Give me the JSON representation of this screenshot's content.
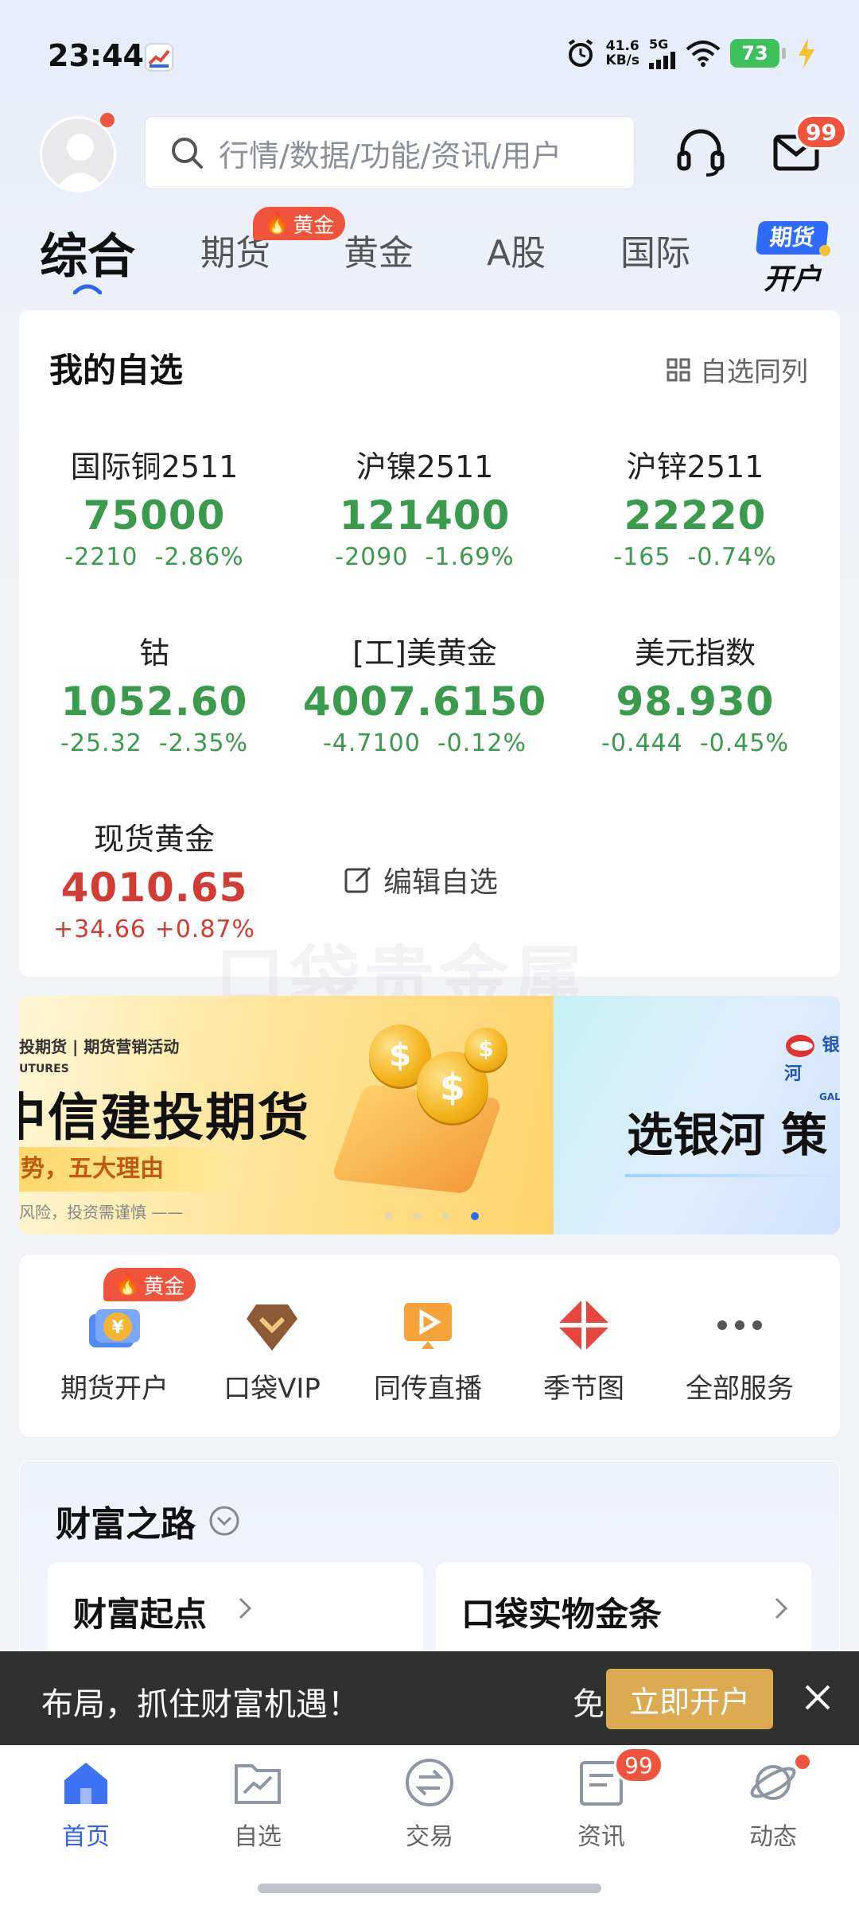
{
  "status_bar": {
    "time": "23:44",
    "net_speed": "41.6",
    "net_unit": "KB/s",
    "network": "5G",
    "battery": "73"
  },
  "header": {
    "search_placeholder": "行情/数据/功能/资讯/用户",
    "mail_badge": "99"
  },
  "tabs": [
    {
      "label": "综合",
      "active": true
    },
    {
      "label": "期货",
      "badge": "黄金"
    },
    {
      "label": "黄金"
    },
    {
      "label": "A股"
    },
    {
      "label": "国际"
    }
  ],
  "open_account_ad": {
    "line1": "期货",
    "line2": "开户"
  },
  "watchlist": {
    "title": "我的自选",
    "sync_label": "自选同列",
    "edit_label": "编辑自选",
    "items": [
      {
        "name": "国际铜2511",
        "price": "75000",
        "change": "-2210",
        "pct": "-2.86%",
        "dir": "down"
      },
      {
        "name": "沪镍2511",
        "price": "121400",
        "change": "-2090",
        "pct": "-1.69%",
        "dir": "down"
      },
      {
        "name": "沪锌2511",
        "price": "22220",
        "change": "-165",
        "pct": "-0.74%",
        "dir": "down"
      },
      {
        "name": "钴",
        "price": "1052.60",
        "change": "-25.32",
        "pct": "-2.35%",
        "dir": "down"
      },
      {
        "name": "[工]美黄金",
        "price": "4007.6150",
        "change": "-4.7100",
        "pct": "-0.12%",
        "dir": "down"
      },
      {
        "name": "美元指数",
        "price": "98.930",
        "change": "-0.444",
        "pct": "-0.45%",
        "dir": "down"
      },
      {
        "name": "现货黄金",
        "price": "4010.65",
        "change": "+34.66",
        "pct": "+0.87%",
        "dir": "up"
      }
    ],
    "watermark": "口袋贵金属"
  },
  "banner": {
    "small_text": "投期货 | 期货营销活动",
    "small_text2": "UTURES",
    "big_text": "中信建投期货",
    "pill_text": "势，五大理由",
    "foot_text": "风险，投资需谨慎 ——",
    "right_title": "选银河 策",
    "right_logo": "银河",
    "right_logo_sub": "GALAX",
    "active_dot": 3
  },
  "services": [
    {
      "label": "期货开户",
      "icon": "futures-account-icon",
      "badge": "黄金"
    },
    {
      "label": "口袋VIP",
      "icon": "vip-diamond-icon"
    },
    {
      "label": "同传直播",
      "icon": "live-play-icon"
    },
    {
      "label": "季节图",
      "icon": "season-chart-icon"
    },
    {
      "label": "全部服务",
      "icon": "more-dots-icon"
    }
  ],
  "wealth": {
    "title": "财富之路",
    "cards": [
      "财富起点",
      "口袋实物金条"
    ]
  },
  "promo": {
    "text": "布局，抓住财富机遇！",
    "free_text": "免",
    "button": "立即开户"
  },
  "bottom_nav": [
    {
      "label": "首页",
      "icon": "home-icon",
      "active": true
    },
    {
      "label": "自选",
      "icon": "watchlist-folder-icon"
    },
    {
      "label": "交易",
      "icon": "trade-exchange-icon"
    },
    {
      "label": "资讯",
      "icon": "news-icon",
      "badge": "99"
    },
    {
      "label": "动态",
      "icon": "planet-icon"
    }
  ],
  "colors": {
    "accent": "#2f63f0",
    "down": "#3a9b4c",
    "up": "#d23c34",
    "badge": "#f0543c",
    "promo_button": "#dcaa50"
  }
}
